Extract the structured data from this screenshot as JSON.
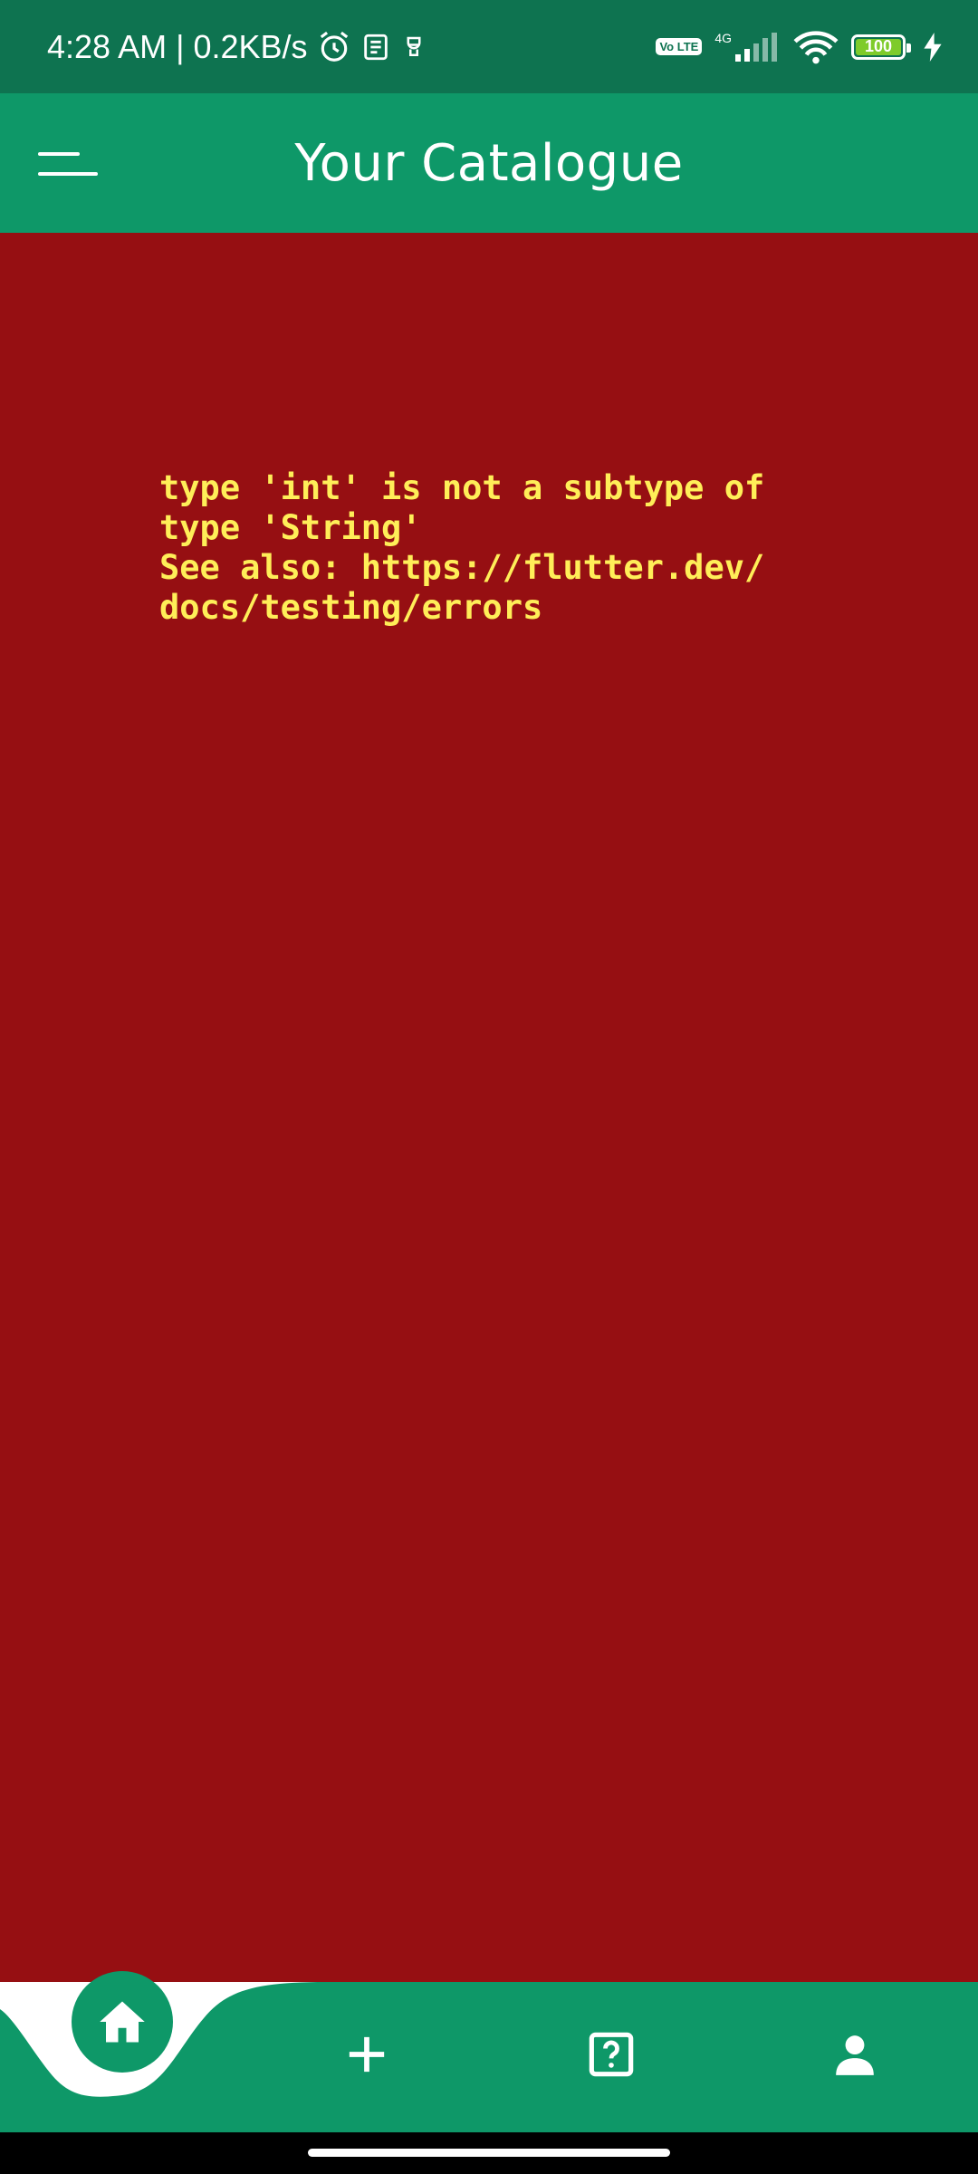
{
  "status_bar": {
    "time_speed": "4:28 AM | 0.2KB/s",
    "volte_label": "Vo LTE",
    "network_label": "4G",
    "battery_level": "100",
    "icons": [
      "alarm-icon",
      "news-icon",
      "lamp-icon",
      "volte-icon",
      "signal-icon",
      "wifi-icon",
      "battery-icon",
      "charging-icon"
    ]
  },
  "app_bar": {
    "title": "Your Catalogue",
    "menu_icon": "menu-icon"
  },
  "error": {
    "message": "type 'int' is not a subtype of\ntype 'String'\nSee also: https://flutter.dev/\ndocs/testing/errors"
  },
  "bottom_nav": {
    "items": [
      {
        "icon": "home-icon",
        "active": true
      },
      {
        "icon": "plus-icon"
      },
      {
        "icon": "help-icon"
      },
      {
        "icon": "profile-icon"
      }
    ]
  },
  "colors": {
    "status_bar": "#0e7350",
    "accent": "#0e9868",
    "error_background": "#960f12",
    "error_text": "#ffee58"
  }
}
